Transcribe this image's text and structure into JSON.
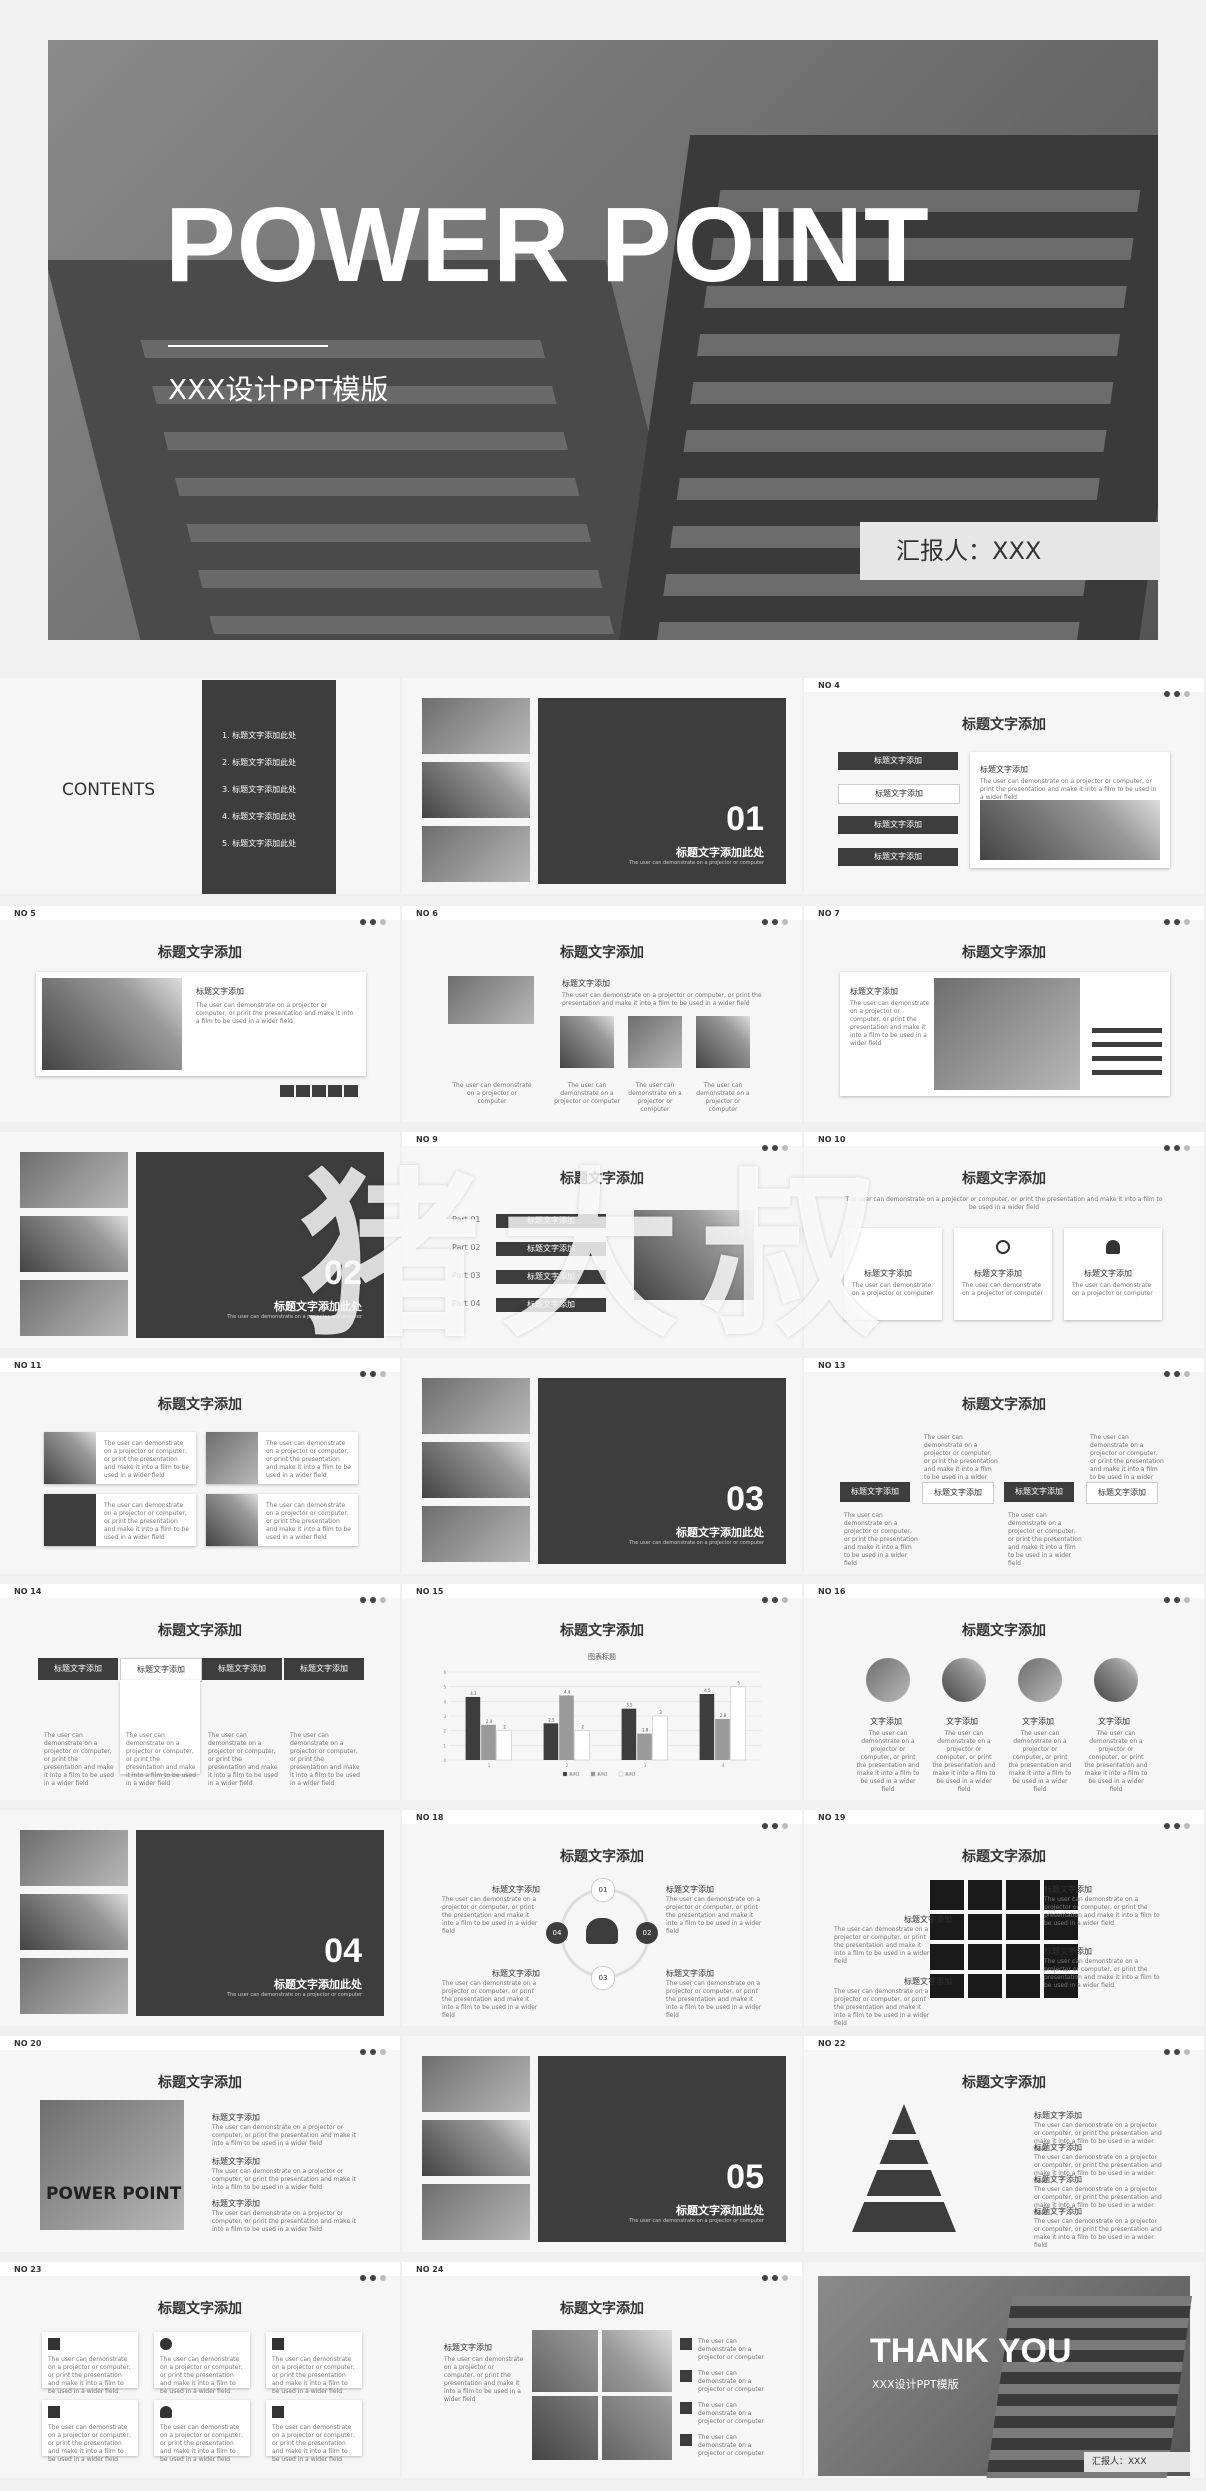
{
  "hero": {
    "title": "POWER POINT",
    "subtitle": "XXX设计PPT模版",
    "reporter": "汇报人：XXX"
  },
  "common": {
    "title": "标题文字添加",
    "title_here": "标题文字添加此处",
    "lorem": "The user can demonstrate on a projector or computer, or print the presentation and make it into a film to be used in a wider field",
    "lorem_short": "The user can demonstrate on a projector or computer",
    "text_add": "文字添加"
  },
  "contents": {
    "heading": "CONTENTS",
    "items": [
      "1. 标题文字添加此处",
      "2. 标题文字添加此处",
      "3. 标题文字添加此处",
      "4. 标题文字添加此处",
      "5. 标题文字添加此处"
    ]
  },
  "slides": {
    "s4": {
      "no": "NO   4"
    },
    "s5": {
      "no": "NO   5"
    },
    "s6": {
      "no": "NO   6"
    },
    "s7": {
      "no": "NO   7"
    },
    "s9": {
      "no": "NO   9",
      "parts": [
        "Part 01",
        "Part 02",
        "Part 03",
        "Part 04"
      ]
    },
    "s10": {
      "no": "NO   10"
    },
    "s11": {
      "no": "NO   11"
    },
    "s13": {
      "no": "NO   13"
    },
    "s14": {
      "no": "NO   14"
    },
    "s15": {
      "no": "NO   15"
    },
    "s16": {
      "no": "NO   16"
    },
    "s18": {
      "no": "NO   18"
    },
    "s19": {
      "no": "NO   19"
    },
    "s20": {
      "no": "NO   20",
      "image_title": "POWER POINT"
    },
    "s22": {
      "no": "NO   22"
    },
    "s23": {
      "no": "NO   23"
    },
    "s24": {
      "no": "NO   24"
    }
  },
  "section_numbers": [
    "01",
    "02",
    "03",
    "04",
    "05"
  ],
  "cycle_labels": [
    "01",
    "02",
    "03",
    "04"
  ],
  "thankyou": {
    "title": "THANK YOU",
    "subtitle": "XXX设计PPT模版",
    "reporter": "汇报人：XXX"
  },
  "watermark": "猪大叔",
  "chart_data": {
    "type": "bar",
    "title": "图表标题",
    "categories": [
      "1",
      "2",
      "3",
      "4"
    ],
    "series": [
      {
        "name": "系列1",
        "values": [
          4.3,
          2.5,
          3.5,
          4.5
        ]
      },
      {
        "name": "系列2",
        "values": [
          2.4,
          4.4,
          1.8,
          2.8
        ]
      },
      {
        "name": "系列3",
        "values": [
          2,
          2,
          3,
          5
        ]
      }
    ],
    "data_labels": [
      "4.3",
      "2.4",
      "2",
      "2.5",
      "4.4",
      "2",
      "3.5",
      "1.8",
      "3",
      "4.5",
      "2.8",
      "5"
    ],
    "ylim": [
      0,
      6
    ],
    "colors": [
      "#3d3d3d",
      "#9a9a9a",
      "#ffffff"
    ]
  }
}
